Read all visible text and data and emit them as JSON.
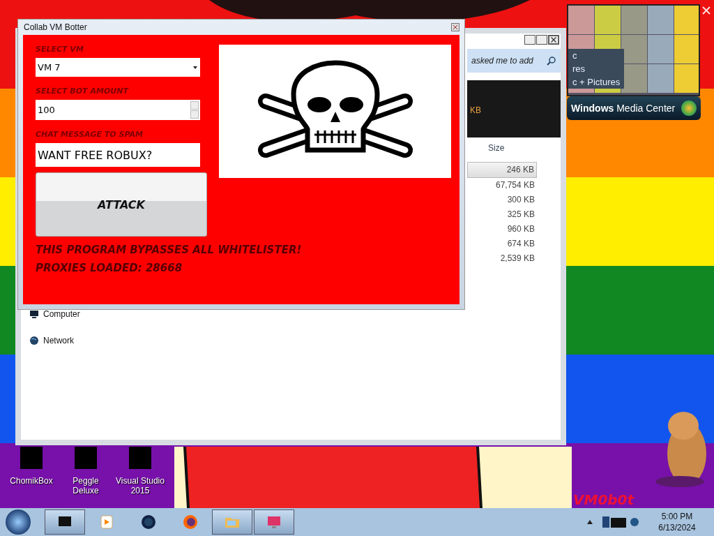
{
  "bot_window": {
    "title": "Collab VM Botter",
    "vm_label": "SELECT VM",
    "vm_value": "VM 7",
    "amount_label": "SELECT BOT AMOUNT",
    "amount_value": "100",
    "message_label": "CHAT MESSAGE TO SPAM",
    "message_value": "WANT FREE ROBUX?",
    "attack_button": "ATTACK",
    "notes": [
      "THIS PROGRAM BYPASSES ALL WHITELISTER!",
      "PROXIES LOADED: 28668"
    ]
  },
  "explorer": {
    "search_placeholder": "asked me to add",
    "toolbar_text": "KB",
    "size_header": "Size",
    "sizes": [
      {
        "text": "246 KB",
        "selected": true
      },
      {
        "text": "67,754 KB",
        "selected": false
      },
      {
        "text": "300 KB",
        "selected": false
      },
      {
        "text": "325 KB",
        "selected": false
      },
      {
        "text": "960 KB",
        "selected": false
      },
      {
        "text": "674 KB",
        "selected": false
      },
      {
        "text": "2,539 KB",
        "selected": false
      }
    ],
    "nav_items": [
      {
        "label": "Computer",
        "kind": "computer"
      },
      {
        "label": "Network",
        "kind": "network"
      }
    ]
  },
  "media_center": {
    "menu": [
      "c",
      "res",
      "c + Pictures"
    ],
    "title_bold": "Windows",
    "title_rest": "Media Center"
  },
  "desktop_icons": [
    {
      "label": "ChomikBox"
    },
    {
      "label": "Peggle Deluxe"
    },
    {
      "label": "Visual Studio 2015"
    }
  ],
  "wallpaper_text": "VM0b0t",
  "taskbar": {
    "buttons": [
      {
        "kind": "monitor",
        "selected": true
      },
      {
        "kind": "media",
        "selected": false
      },
      {
        "kind": "globe",
        "selected": false
      },
      {
        "kind": "firefox",
        "selected": false
      },
      {
        "kind": "folder",
        "selected": true
      },
      {
        "kind": "screen",
        "selected": true
      }
    ],
    "time": "5:00 PM",
    "date": "6/13/2024"
  }
}
